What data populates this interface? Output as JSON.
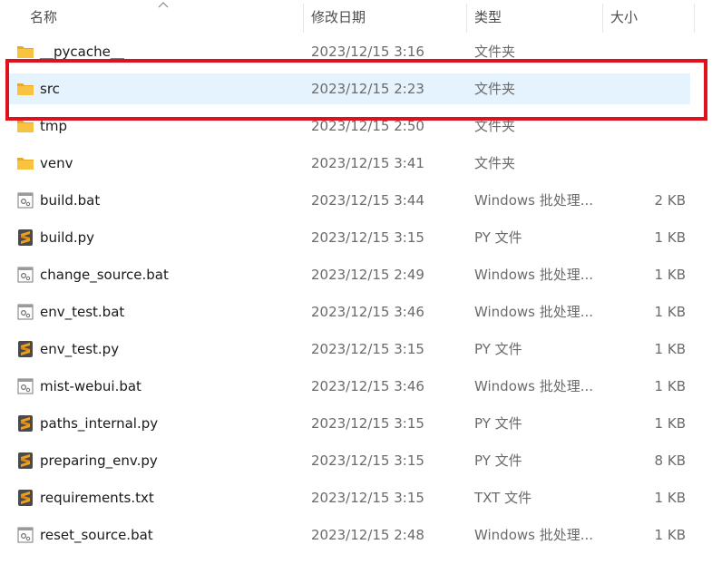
{
  "columns": {
    "name": "名称",
    "date": "修改日期",
    "type": "类型",
    "size": "大小"
  },
  "colors": {
    "selection": "#e5f3fe",
    "highlight_box": "#e0101c",
    "folder": "#f8c440",
    "python_icon": "#f0a020"
  },
  "files": [
    {
      "name": "__pycache__",
      "date": "2023/12/15 3:16",
      "type": "文件夹",
      "size": "",
      "icon": "folder-icon"
    },
    {
      "name": "src",
      "date": "2023/12/15 2:23",
      "type": "文件夹",
      "size": "",
      "icon": "folder-icon",
      "selected": true
    },
    {
      "name": "tmp",
      "date": "2023/12/15 2:50",
      "type": "文件夹",
      "size": "",
      "icon": "folder-icon"
    },
    {
      "name": "venv",
      "date": "2023/12/15 3:41",
      "type": "文件夹",
      "size": "",
      "icon": "folder-icon"
    },
    {
      "name": "build.bat",
      "date": "2023/12/15 3:44",
      "type": "Windows 批处理...",
      "size": "2 KB",
      "icon": "batch-file-icon"
    },
    {
      "name": "build.py",
      "date": "2023/12/15 3:15",
      "type": "PY 文件",
      "size": "1 KB",
      "icon": "sublime-file-icon"
    },
    {
      "name": "change_source.bat",
      "date": "2023/12/15 2:49",
      "type": "Windows 批处理...",
      "size": "1 KB",
      "icon": "batch-file-icon"
    },
    {
      "name": "env_test.bat",
      "date": "2023/12/15 3:46",
      "type": "Windows 批处理...",
      "size": "1 KB",
      "icon": "batch-file-icon"
    },
    {
      "name": "env_test.py",
      "date": "2023/12/15 3:15",
      "type": "PY 文件",
      "size": "1 KB",
      "icon": "sublime-file-icon"
    },
    {
      "name": "mist-webui.bat",
      "date": "2023/12/15 3:46",
      "type": "Windows 批处理...",
      "size": "1 KB",
      "icon": "batch-file-icon"
    },
    {
      "name": "paths_internal.py",
      "date": "2023/12/15 3:15",
      "type": "PY 文件",
      "size": "1 KB",
      "icon": "sublime-file-icon"
    },
    {
      "name": "preparing_env.py",
      "date": "2023/12/15 3:15",
      "type": "PY 文件",
      "size": "8 KB",
      "icon": "sublime-file-icon"
    },
    {
      "name": "requirements.txt",
      "date": "2023/12/15 3:15",
      "type": "TXT 文件",
      "size": "1 KB",
      "icon": "sublime-file-icon"
    },
    {
      "name": "reset_source.bat",
      "date": "2023/12/15 2:48",
      "type": "Windows 批处理...",
      "size": "1 KB",
      "icon": "batch-file-icon"
    }
  ]
}
